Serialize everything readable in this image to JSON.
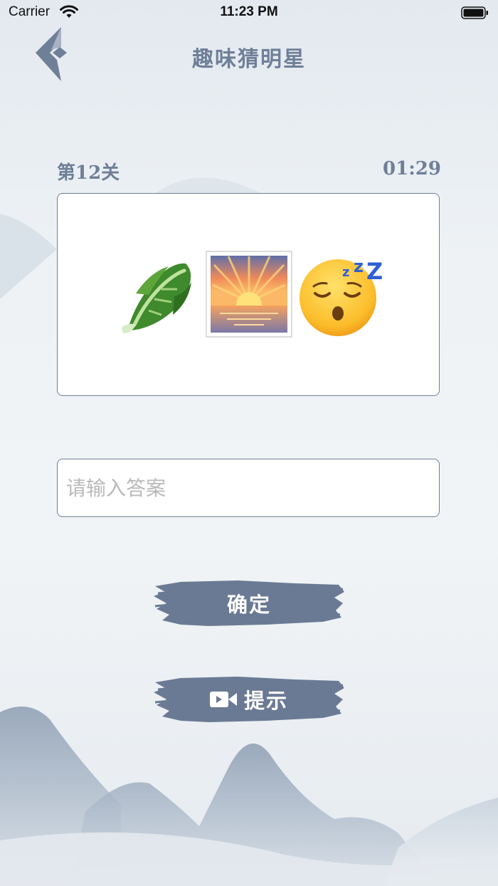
{
  "status_bar": {
    "carrier": "Carrier",
    "time": "11:23 PM"
  },
  "nav": {
    "title": "趣味猜明星",
    "back_icon": "back-chevron-icon"
  },
  "level": {
    "label": "第12关",
    "timer": "01:29"
  },
  "puzzle": {
    "emojis": [
      "leafy-green-emoji",
      "sunrise-emoji",
      "sleeping-face-emoji"
    ]
  },
  "answer": {
    "placeholder": "请输入答案",
    "value": ""
  },
  "buttons": {
    "confirm_label": "确定",
    "hint_label": "提示",
    "hint_icon": "video-camera-icon"
  },
  "colors": {
    "accent": "#6f7f98",
    "button_fill": "#6b7a94",
    "card_bg": "#ffffff",
    "placeholder": "#b9b9b9"
  }
}
